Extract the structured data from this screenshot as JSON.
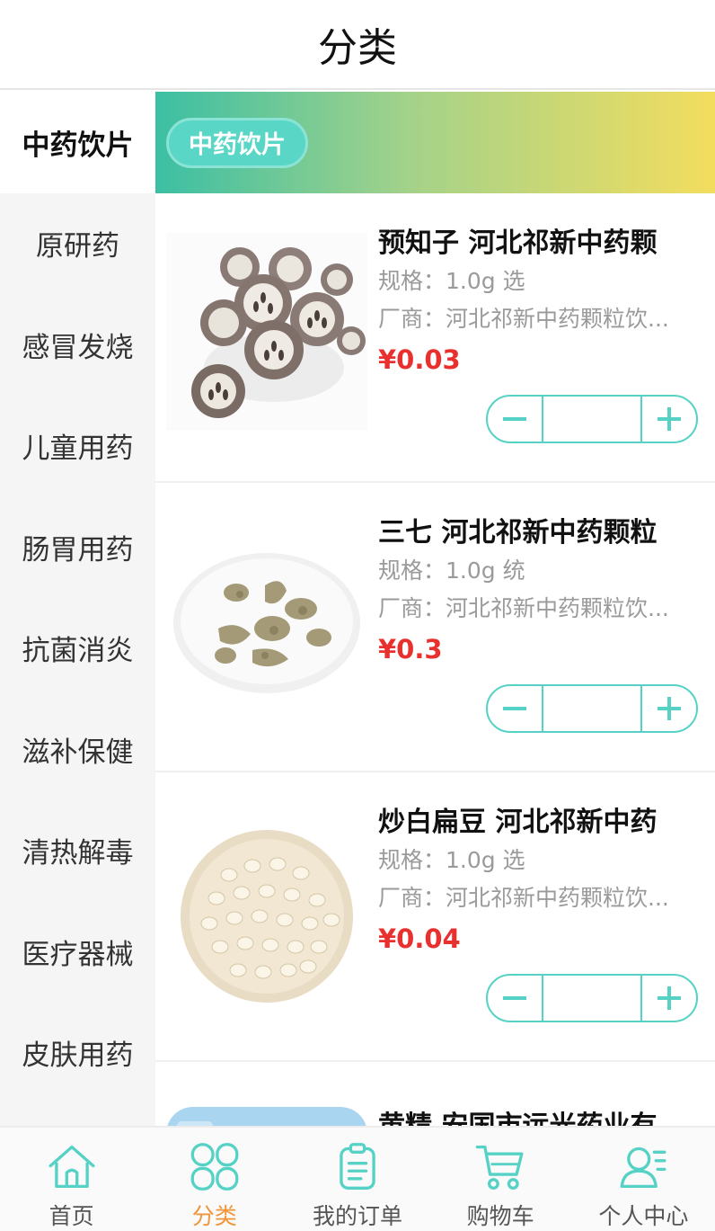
{
  "header": {
    "title": "分类"
  },
  "sidebar": {
    "items": [
      {
        "label": "中药饮片",
        "active": true
      },
      {
        "label": "原研药"
      },
      {
        "label": "感冒发烧"
      },
      {
        "label": "儿童用药"
      },
      {
        "label": "肠胃用药"
      },
      {
        "label": "抗菌消炎"
      },
      {
        "label": "滋补保健"
      },
      {
        "label": "清热解毒"
      },
      {
        "label": "医疗器械"
      },
      {
        "label": "皮肤用药"
      }
    ]
  },
  "banner": {
    "chip_label": "中药饮片"
  },
  "products": [
    {
      "name": "预知子  河北祁新中药颗",
      "spec": "规格：1.0g  选",
      "maker": "厂商：河北祁新中药颗粒饮...",
      "price": "¥0.03",
      "image_icon": "yuzhizi-slices-image"
    },
    {
      "name": "三七  河北祁新中药颗粒",
      "spec": "规格：1.0g  统",
      "maker": "厂商：河北祁新中药颗粒饮...",
      "price": "¥0.3",
      "image_icon": "sanqi-root-image"
    },
    {
      "name": "炒白扁豆  河北祁新中药",
      "spec": "规格：1.0g  选",
      "maker": "厂商：河北祁新中药颗粒饮...",
      "price": "¥0.04",
      "image_icon": "white-beans-image"
    },
    {
      "name": "黄精  安国市远光药业有",
      "image_icon": "huangjing-image"
    }
  ],
  "tabbar": {
    "items": [
      {
        "label": "首页",
        "icon": "home-icon"
      },
      {
        "label": "分类",
        "icon": "category-icon",
        "active": true
      },
      {
        "label": "我的订单",
        "icon": "order-icon"
      },
      {
        "label": "购物车",
        "icon": "cart-icon"
      },
      {
        "label": "个人中心",
        "icon": "profile-icon"
      }
    ]
  },
  "colors": {
    "accent": "#55d2c5",
    "price": "#e8302f",
    "active_tab": "#f0953a"
  }
}
